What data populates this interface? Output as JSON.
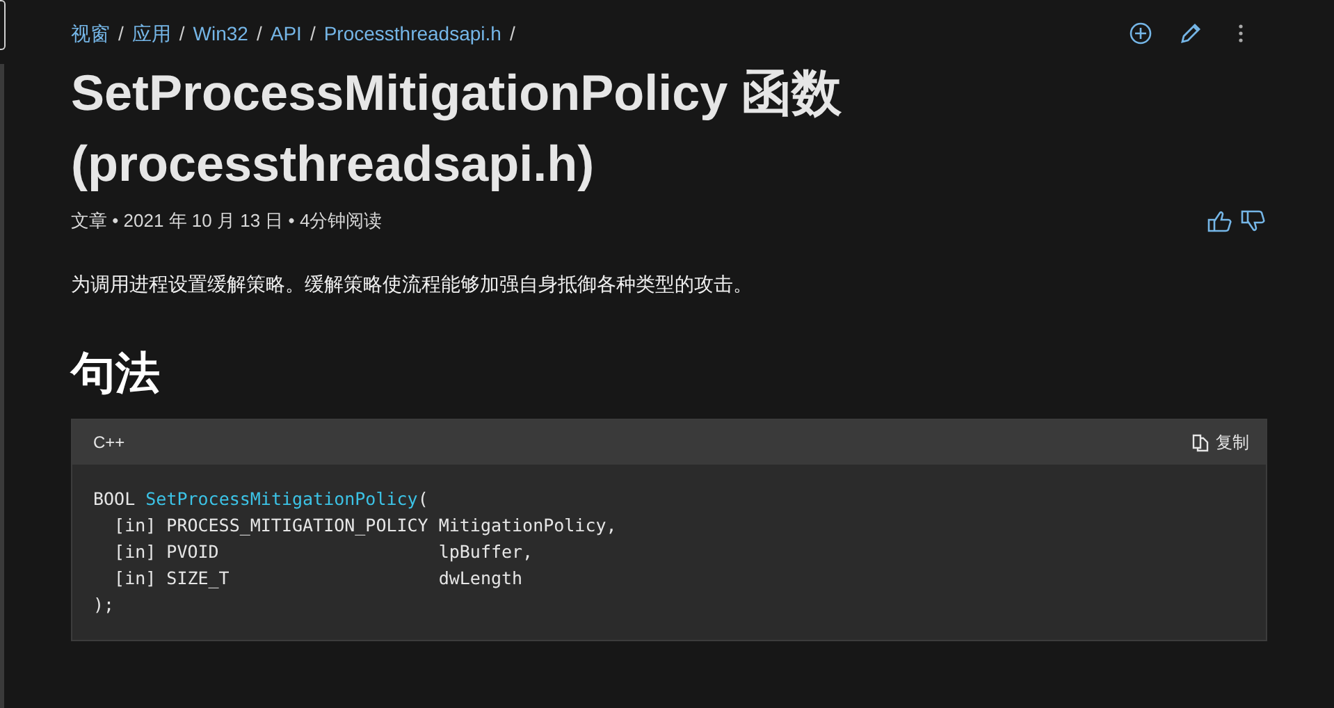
{
  "breadcrumbs": [
    {
      "label": "视窗",
      "separator": "/"
    },
    {
      "label": "应用",
      "separator": "/"
    },
    {
      "label": "Win32",
      "separator": "/"
    },
    {
      "label": "API",
      "separator": "/"
    },
    {
      "label": "Processthreadsapi.h",
      "separator": "/"
    }
  ],
  "title": "SetProcessMitigationPolicy 函数 (processthreadsapi.h)",
  "meta": "文章 • 2021 年 10 月 13 日 • 4分钟阅读",
  "description": "为调用进程设置缓解策略。缓解策略使流程能够加强自身抵御各种类型的攻击。",
  "section_heading": "句法",
  "code_block": {
    "language": "C++",
    "copy_label": "复制",
    "lines": [
      [
        {
          "kind": "plain",
          "text": "BOOL "
        },
        {
          "kind": "function",
          "text": "SetProcessMitigationPolicy"
        },
        {
          "kind": "plain",
          "text": "("
        }
      ],
      [
        {
          "kind": "plain",
          "text": "  [in] PROCESS_MITIGATION_POLICY MitigationPolicy,"
        }
      ],
      [
        {
          "kind": "plain",
          "text": "  [in] PVOID                     lpBuffer,"
        }
      ],
      [
        {
          "kind": "plain",
          "text": "  [in] SIZE_T                    dwLength"
        }
      ],
      [
        {
          "kind": "plain",
          "text": ");"
        }
      ]
    ]
  }
}
